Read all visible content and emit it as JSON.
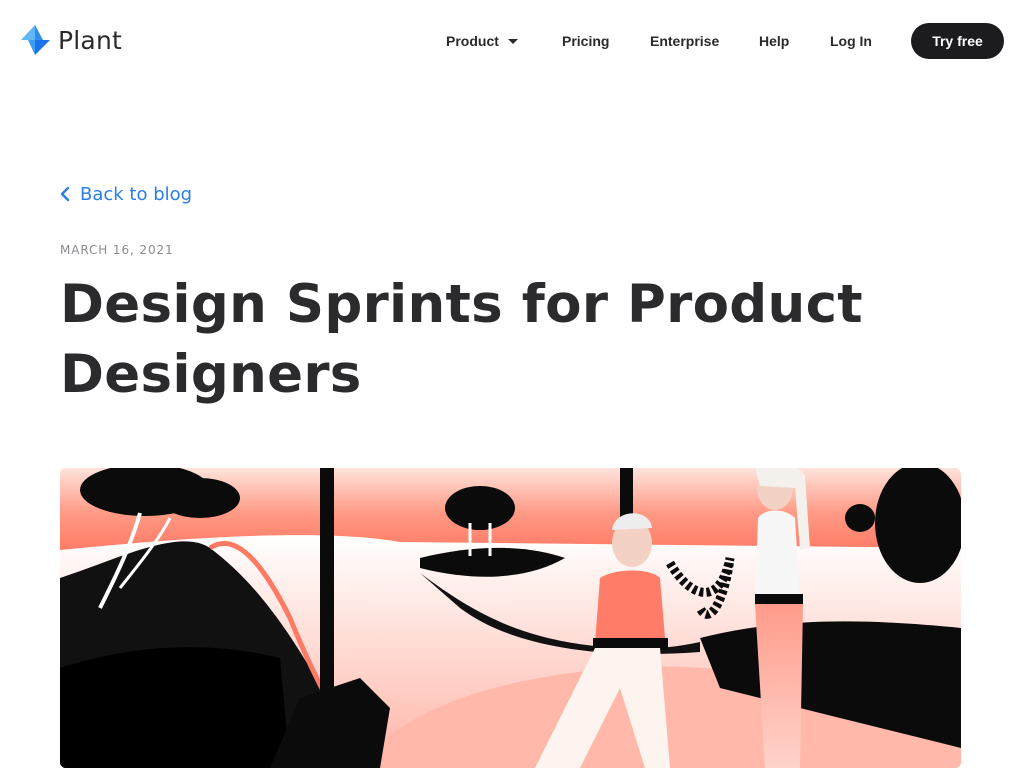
{
  "brand": {
    "name": "Plant",
    "logo_icon": "plant-logo-icon",
    "colors": {
      "logo_light": "#5fb7f5",
      "logo_dark": "#1a73e8",
      "link": "#2b7de9",
      "cta_bg": "#1c1c1e"
    }
  },
  "nav": {
    "items": [
      {
        "label": "Product",
        "has_dropdown": true
      },
      {
        "label": "Pricing"
      },
      {
        "label": "Enterprise"
      },
      {
        "label": "Help"
      },
      {
        "label": "Log In"
      }
    ],
    "cta_label": "Try free"
  },
  "article": {
    "back_label": "Back to blog",
    "date": "MARCH 16, 2021",
    "title": "Design Sprints for Product Designers",
    "hero_image": "illustration-two-figures-landscape"
  }
}
